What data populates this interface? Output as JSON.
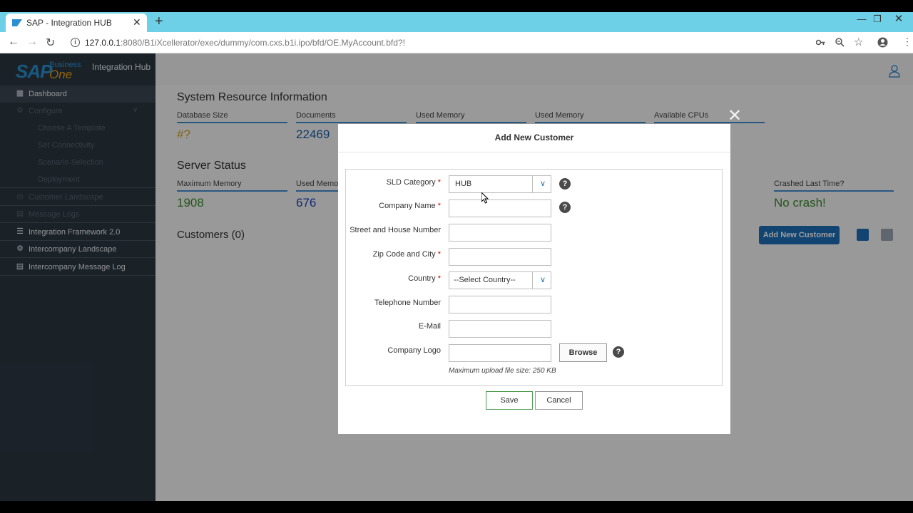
{
  "browser": {
    "tab_title": "SAP - Integration HUB",
    "tab_close": "✕",
    "new_tab": "+",
    "url_host": "127.0.0.1",
    "url_rest": ":8080/B1iXcellerator/exec/dummy/com.cxs.b1i.ipo/bfd/OE.MyAccount.bfd?!",
    "window_controls": {
      "minimize": "—",
      "restore": "❐",
      "close": "✕"
    }
  },
  "brand": {
    "logo_sap": "SAP",
    "logo_business": "Business",
    "logo_one": "One",
    "app_name": "Integration Hub"
  },
  "sidebar": {
    "items": [
      {
        "label": "Dashboard",
        "icon": "dashboard-icon"
      },
      {
        "label": "Configure",
        "icon": "gears-icon"
      },
      {
        "label": "Choose A Template"
      },
      {
        "label": "Set Connectivity"
      },
      {
        "label": "Scenario Selection"
      },
      {
        "label": "Deployment"
      },
      {
        "label": "Customer Landscape",
        "icon": "user-circle-icon"
      },
      {
        "label": "Message Logs",
        "icon": "clipboard-icon"
      },
      {
        "label": "Integration Framework 2.0",
        "icon": "bars-icon"
      },
      {
        "label": "Intercompany Landscape",
        "icon": "gear-icon"
      },
      {
        "label": "Intercompany Message Log",
        "icon": "clipboard-icon"
      }
    ]
  },
  "system_resource": {
    "title": "System Resource Information",
    "metrics": [
      {
        "label": "Database Size",
        "value": "#?",
        "color": "#d4a21a"
      },
      {
        "label": "Documents",
        "value": "22469",
        "color": "#1d5fa8"
      },
      {
        "label": "Used Memory",
        "value": ""
      },
      {
        "label": "Used Memory",
        "value": ""
      },
      {
        "label": "Available CPUs",
        "value": ""
      }
    ]
  },
  "server_status": {
    "title": "Server Status",
    "metrics": [
      {
        "label": "Maximum Memory",
        "value": "1908",
        "color": "#3a8a2e"
      },
      {
        "label": "Used Memor",
        "value": "676",
        "color": "#1f3fbf"
      },
      {
        "label": "Crashed Last Time?",
        "value": "No crash!",
        "color": "#3a8a2e"
      }
    ]
  },
  "customers": {
    "title": "Customers (0)",
    "add_button": "Add New Customer"
  },
  "modal": {
    "close": "✕",
    "title": "Add New Customer",
    "fields": {
      "sld_category": {
        "label": "SLD Category",
        "value": "HUB"
      },
      "company_name": {
        "label": "Company Name",
        "value": ""
      },
      "street": {
        "label": "Street and House Number",
        "value": ""
      },
      "zip_city": {
        "label": "Zip Code and City",
        "value": ""
      },
      "country": {
        "label": "Country",
        "value": "--Select Country--"
      },
      "telephone": {
        "label": "Telephone Number",
        "value": ""
      },
      "email": {
        "label": "E-Mail",
        "value": ""
      },
      "logo": {
        "label": "Company Logo",
        "value": ""
      }
    },
    "required_mark": "*",
    "help_glyph": "?",
    "browse_button": "Browse",
    "upload_note": "Maximum upload file size: 250 KB",
    "save_button": "Save",
    "cancel_button": "Cancel"
  },
  "colors": {
    "accent": "#1d6fb8",
    "sidebar_bg": "#2b3742",
    "tabstrip": "#6ed0e6",
    "required": "#d40000"
  }
}
